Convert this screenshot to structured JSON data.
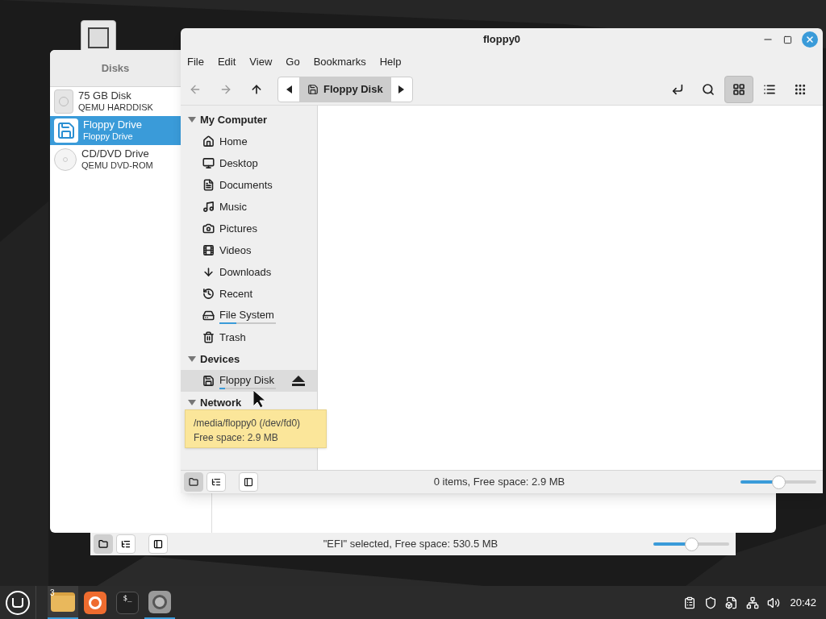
{
  "back_window": {
    "status_buttons": [
      {
        "kind": "places",
        "selected": true
      },
      {
        "kind": "tree",
        "selected": false
      },
      {
        "kind": "toggle",
        "selected": false
      }
    ],
    "status": "\"EFI\" selected, Free space: 530.5 MB",
    "zoom": {
      "level": 0.5
    }
  },
  "disks_window": {
    "title": "Disks",
    "disks": [
      {
        "name": "75 GB Disk",
        "model": "QEMU HARDDISK",
        "kind": "hdd",
        "selected": false
      },
      {
        "name": "Floppy Drive",
        "model": "Floppy Drive",
        "kind": "floppy",
        "selected": true
      },
      {
        "name": "CD/DVD Drive",
        "model": "QEMU DVD-ROM",
        "kind": "optical",
        "selected": false
      }
    ]
  },
  "file_window": {
    "title": "floppy0",
    "menu": [
      "File",
      "Edit",
      "View",
      "Go",
      "Bookmarks",
      "Help"
    ],
    "location": "Floppy Disk",
    "view_buttons": [
      {
        "kind": "icons",
        "selected": true
      },
      {
        "kind": "list",
        "selected": false
      },
      {
        "kind": "compact",
        "selected": false
      }
    ],
    "sidebar": [
      {
        "heading": "My Computer",
        "expanded": true,
        "items": [
          {
            "label": "Home",
            "kind": "home",
            "selected": false
          },
          {
            "label": "Desktop",
            "kind": "desktop",
            "selected": false
          },
          {
            "label": "Documents",
            "kind": "documents",
            "selected": false
          },
          {
            "label": "Music",
            "kind": "music",
            "selected": false
          },
          {
            "label": "Pictures",
            "kind": "pictures",
            "selected": false
          },
          {
            "label": "Videos",
            "kind": "videos",
            "selected": false
          },
          {
            "label": "Downloads",
            "kind": "downloads",
            "selected": false
          },
          {
            "label": "Recent",
            "kind": "recent",
            "selected": false
          },
          {
            "label": "File System",
            "kind": "filesystem",
            "selected": false,
            "level": 0.3
          },
          {
            "label": "Trash",
            "kind": "trash",
            "selected": false
          }
        ]
      },
      {
        "heading": "Devices",
        "expanded": true,
        "items": [
          {
            "label": "Floppy Disk",
            "kind": "floppy",
            "selected": true,
            "level": 0.1,
            "eject": true
          }
        ]
      },
      {
        "heading": "Network",
        "expanded": true
      }
    ],
    "tooltip": [
      "/media/floppy0 (/dev/fd0)",
      "Free space: 2.9 MB"
    ],
    "status_buttons": [
      {
        "kind": "places",
        "selected": true
      },
      {
        "kind": "tree",
        "selected": false
      },
      {
        "kind": "toggle",
        "selected": false
      }
    ],
    "status": "0 items, Free space: 2.9 MB",
    "zoom": {
      "level": 0.5
    }
  },
  "taskbar": {
    "apps": [
      {
        "kind": "files",
        "badge": "3",
        "active": true
      },
      {
        "kind": "firefox",
        "active": false
      },
      {
        "kind": "terminal",
        "label": "$_",
        "active": false
      },
      {
        "kind": "disks",
        "active": true
      }
    ],
    "clock": "20:42"
  }
}
